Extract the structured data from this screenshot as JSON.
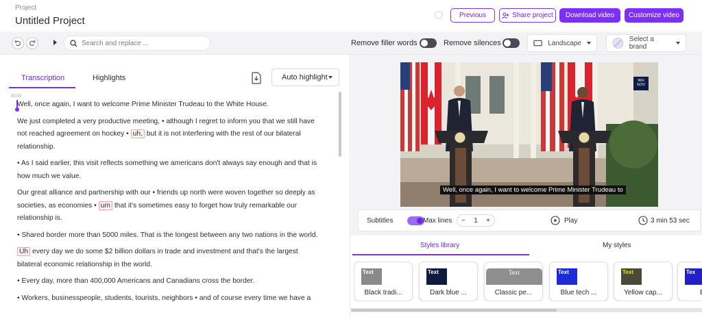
{
  "header": {
    "project_label": "Project",
    "project_name": "Untitled Project",
    "buttons": {
      "previous": "Previous",
      "share": "Share project",
      "download": "Download video",
      "customize": "Customize video"
    }
  },
  "toolbar": {
    "search_placeholder": "Search and replace ...",
    "remove_filler_label": "Remove filler words",
    "remove_filler_on": false,
    "remove_silences_label": "Remove silences",
    "remove_silences_on": false,
    "orientation": "Landscape",
    "brand": "Select a brand"
  },
  "transcript_panel": {
    "tabs": [
      "Transcription",
      "Highlights"
    ],
    "active_tab": "Transcription",
    "auto_highlight": "Auto highlight",
    "timestamp": "00:00",
    "paragraphs": [
      {
        "segments": [
          {
            "text": "Well, once again, I want to welcome Prime Minister Trudeau to the White House."
          }
        ]
      },
      {
        "segments": [
          {
            "text": "We just completed a very productive meeting, • although I regret to inform you that we still have not reached agreement on hockey • "
          },
          {
            "text": "uh,",
            "filler": true
          },
          {
            "text": " but it is not interfering with the rest of our bilateral relationship."
          }
        ]
      },
      {
        "segments": [
          {
            "text": "• As I said earlier, this visit reflects something we americans don't always say enough and that is how much we value."
          }
        ]
      },
      {
        "segments": [
          {
            "text": "Our great alliance and partnership with our • friends up north were woven together so deeply as societies, as economies • "
          },
          {
            "text": "um",
            "filler": true
          },
          {
            "text": " that it's sometimes easy to forget how truly remarkable our relationship is."
          }
        ]
      },
      {
        "segments": [
          {
            "text": "• Shared border more than 5000 miles. That is the longest between any two nations in the world."
          }
        ]
      },
      {
        "segments": [
          {
            "text": "Uh",
            "filler": true
          },
          {
            "text": " every day we do some $2 billion dollars in trade and investment and that's the largest bilateral economic relationship in the world."
          }
        ]
      },
      {
        "segments": [
          {
            "text": "• Every day, more than 400,000 Americans and Canadians cross the border."
          }
        ]
      },
      {
        "segments": [
          {
            "text": "• Workers, businesspeople, students, tourists, neighbors • and of course every time we have a"
          }
        ]
      }
    ]
  },
  "video_panel": {
    "subtitle_text": "Well, once again, I want to welcome Prime Minister Trudeau to",
    "subtitles_label": "Subtitles",
    "subtitles_on": true,
    "max_lines_label": "Max lines",
    "max_lines_value": "1",
    "play_label": "Play",
    "duration": "3 min 53 sec",
    "watermark": "WH GOV"
  },
  "styles": {
    "tabs": [
      "Styles library",
      "My styles"
    ],
    "active_tab": "Styles library",
    "cards": [
      {
        "name": "Black tradi...",
        "sample": "Text",
        "bg": "#8a8a8a",
        "fg": "#ffffff"
      },
      {
        "name": "Dark blue ...",
        "sample": "Text",
        "bg": "#0d1b3e",
        "fg": "#ffffff"
      },
      {
        "name": "Classic pe...",
        "sample": "Text",
        "bg": "#8f8f8f",
        "fg": "#ffffff"
      },
      {
        "name": "Blue tech ...",
        "sample": "Text",
        "bg": "#1c2bd6",
        "fg": "#ffffff"
      },
      {
        "name": "Yellow cap...",
        "sample": "Text",
        "bg": "#4a4a3a",
        "fg": "#f5e400"
      },
      {
        "name": "Blue",
        "sample": "Tex",
        "bg": "#1f20c8",
        "fg": "#ffffff"
      }
    ]
  }
}
